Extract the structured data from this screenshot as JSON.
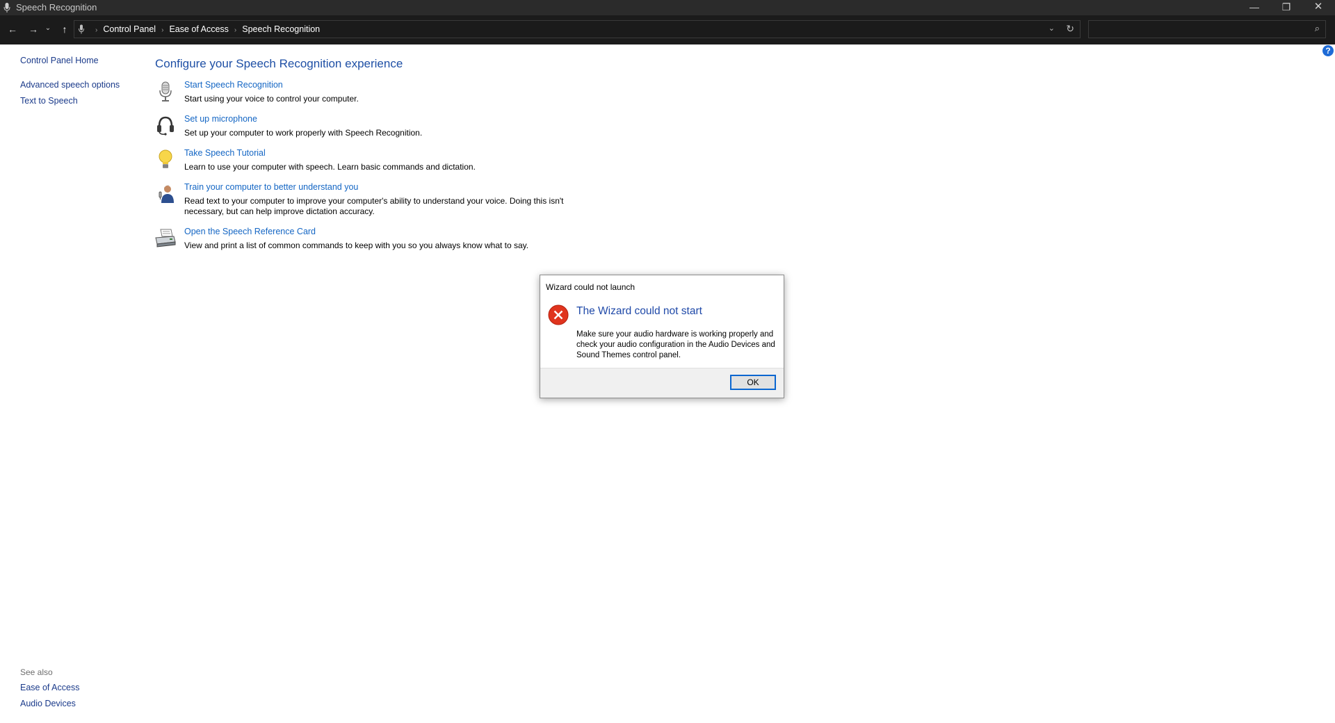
{
  "window": {
    "title": "Speech Recognition",
    "min_glyph": "—",
    "max_glyph": "❐",
    "close_glyph": "✕"
  },
  "nav": {
    "back_glyph": "←",
    "forward_glyph": "→",
    "recent_glyph": "⌄",
    "up_glyph": "↑",
    "breadcrumbs": [
      "Control Panel",
      "Ease of Access",
      "Speech Recognition"
    ],
    "breadcrumb_separator": "›",
    "dropdown_glyph": "⌄",
    "refresh_glyph": "↻",
    "search_value": "",
    "search_placeholder": "",
    "search_glyph": "⌕"
  },
  "help": {
    "glyph": "?"
  },
  "sidebar": {
    "home": "Control Panel Home",
    "links": [
      "Advanced speech options",
      "Text to Speech"
    ],
    "see_also_label": "See also",
    "see_also": [
      "Ease of Access",
      "Audio Devices"
    ]
  },
  "main": {
    "heading": "Configure your Speech Recognition experience",
    "tasks": [
      {
        "icon": "microphone-icon",
        "link": "Start Speech Recognition",
        "desc": "Start using your voice to control your computer."
      },
      {
        "icon": "headset-icon",
        "link": "Set up microphone",
        "desc": "Set up your computer to work properly with Speech Recognition."
      },
      {
        "icon": "lightbulb-icon",
        "link": "Take Speech Tutorial",
        "desc": "Learn to use your computer with speech.  Learn basic commands and dictation."
      },
      {
        "icon": "user-train-icon",
        "link": "Train your computer to better understand you",
        "desc": "Read text to your computer to improve your computer's ability to understand your voice.  Doing this isn't necessary, but can help improve dictation accuracy."
      },
      {
        "icon": "printer-icon",
        "link": "Open the Speech Reference Card",
        "desc": "View and print a list of common commands to keep with you so you always know what to say."
      }
    ]
  },
  "dialog": {
    "title": "Wizard could not launch",
    "icon": "error-icon",
    "main_instruction": "The Wizard could not start",
    "content": "Make sure your audio hardware is working properly and check your audio configuration in the Audio Devices and Sound Themes control panel.",
    "ok_label": "OK"
  },
  "colors": {
    "link": "#1466c4",
    "heading": "#1e4fa5",
    "titlebar": "#2b2b2b",
    "navbar": "#1b1b1b",
    "error_red": "#e0341e",
    "ok_border": "#0a66d0"
  }
}
